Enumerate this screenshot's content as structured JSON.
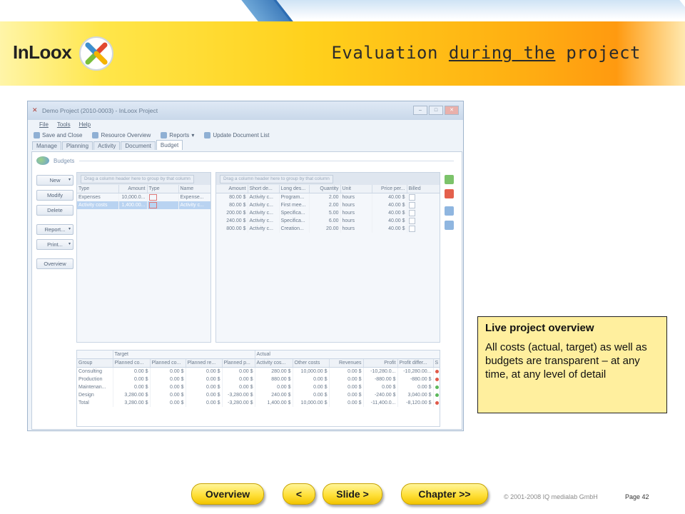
{
  "slide": {
    "title_pre": "Evaluation ",
    "title_underlined": "during the",
    "title_post": " project",
    "logo": "InLoox"
  },
  "window": {
    "title": "Demo Project (2010-0003) - InLoox Project",
    "menu": [
      "File",
      "Tools",
      "Help"
    ],
    "toolbar": [
      "Save and Close",
      "Resource Overview",
      "Reports",
      "Update Document List"
    ],
    "tabs": [
      "Manage",
      "Planning",
      "Activity",
      "Document",
      "Budget"
    ],
    "active_tab": "Budget"
  },
  "budgets": {
    "heading": "Budgets",
    "buttons": [
      "New",
      "Modify",
      "Delete",
      "Report...",
      "Print...",
      "Overview"
    ]
  },
  "left_grid": {
    "drag_hint": "Drag a column header here to group by that column",
    "columns": [
      "Type",
      "Amount",
      "Type",
      "Name"
    ],
    "rows": [
      [
        "Expenses",
        "10,000.0...",
        "",
        "Expense..."
      ],
      [
        "Activity costs",
        "1,400.00...",
        "",
        "Activity c..."
      ]
    ]
  },
  "right_grid": {
    "drag_hint": "Drag a column header here to group by that column",
    "columns": [
      "Amount",
      "Short de...",
      "Long des...",
      "Quantity",
      "Unit",
      "Price per...",
      "Billed"
    ],
    "rows": [
      [
        "80.00 $",
        "Activity c...",
        "Program...",
        "2.00",
        "hours",
        "40.00 $"
      ],
      [
        "80.00 $",
        "Activity c...",
        "First mee...",
        "2.00",
        "hours",
        "40.00 $"
      ],
      [
        "200.00 $",
        "Activity c...",
        "Specifica...",
        "5.00",
        "hours",
        "40.00 $"
      ],
      [
        "240.00 $",
        "Activity c...",
        "Specifica...",
        "6.00",
        "hours",
        "40.00 $"
      ],
      [
        "800.00 $",
        "Activity c...",
        "Creation...",
        "20.00",
        "hours",
        "40.00 $"
      ]
    ]
  },
  "summary_grid": {
    "group_target": "Target",
    "group_actual": "Actual",
    "columns": [
      "Group",
      "Planned co...",
      "Planned co...",
      "Planned re...",
      "Planned p...",
      "Activity cos...",
      "Other costs",
      "Revenues",
      "Profit",
      "Profit differ...",
      "S"
    ],
    "rows": [
      [
        "Consulting",
        "0.00 $",
        "0.00 $",
        "0.00 $",
        "0.00 $",
        "280.00 $",
        "10,000.00 $",
        "0.00 $",
        "-10,280.0...",
        "-10,280.00..."
      ],
      [
        "Production",
        "0.00 $",
        "0.00 $",
        "0.00 $",
        "0.00 $",
        "880.00 $",
        "0.00 $",
        "0.00 $",
        "-880.00 $",
        "-880.00 $"
      ],
      [
        "Maintenan...",
        "0.00 $",
        "0.00 $",
        "0.00 $",
        "0.00 $",
        "0.00 $",
        "0.00 $",
        "0.00 $",
        "0.00 $",
        "0.00 $"
      ],
      [
        "Design",
        "3,280.00 $",
        "0.00 $",
        "0.00 $",
        "-3,280.00 $",
        "240.00 $",
        "0.00 $",
        "0.00 $",
        "-240.00 $",
        "3,040.00 $"
      ],
      [
        "Total",
        "3,280.00 $",
        "0.00 $",
        "0.00 $",
        "-3,280.00 $",
        "1,400.00 $",
        "10,000.00 $",
        "0.00 $",
        "-11,400.0...",
        "-8,120.00 $"
      ]
    ],
    "status_colors": [
      "#e05a4a",
      "#e05a4a",
      "#5cb85c",
      "#5cb85c",
      "#e05a4a"
    ]
  },
  "callout": {
    "heading": "Live project overview",
    "body": "All costs (actual, target) as well as budgets are transparent – at any time, at any level of detail"
  },
  "nav": {
    "overview": "Overview",
    "prev": "<",
    "slide": "Slide >",
    "chapter": "Chapter >>"
  },
  "footer": {
    "copyright": "© 2001-2008 IQ medialab GmbH",
    "page": "Page 42"
  },
  "colors": {
    "accent_yellow": "#ffd11c",
    "accent_orange": "#ff9a10",
    "callout_bg": "#ffef9e"
  }
}
